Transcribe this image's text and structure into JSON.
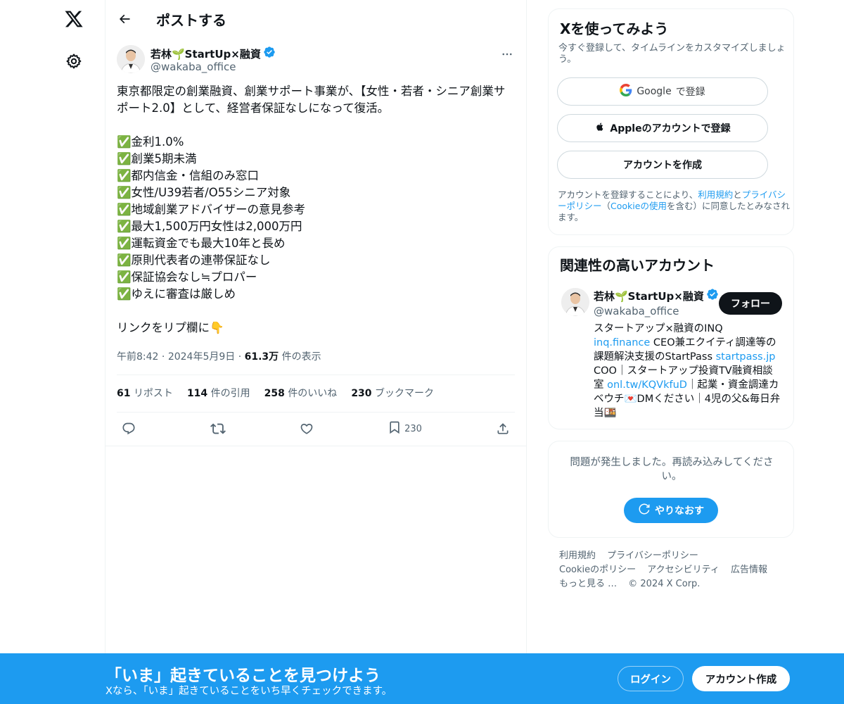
{
  "topbar": {
    "title": "ポストする"
  },
  "post": {
    "author_name": "若林🌱StartUp×融資",
    "author_handle": "@wakaba_office",
    "body": "東京都限定の創業融資、創業サポート事業が、【女性・若者・シニア創業サポート2.0】として、経営者保証なしになって復活。\n\n✅金利1.0%\n✅創業5期未満\n✅都内信金・信組のみ窓口\n✅女性/U39若者/O55シニア対象\n✅地域創業アドバイザーの意見参考\n✅最大1,500万円女性は2,000万円\n✅運転資金でも最大10年と長め\n✅原則代表者の連帯保証なし\n✅保証協会なし≒プロパー\n✅ゆえに審査は厳しめ\n\nリンクをリプ欄に👇",
    "time": "午前8:42",
    "date": "2024年5月9日",
    "views_count": "61.3万",
    "views_label": "件の表示",
    "stats": {
      "reposts_count": "61",
      "reposts_label": "リポスト",
      "quotes_count": "114",
      "quotes_label": "件の引用",
      "likes_count": "258",
      "likes_label": "件のいいね",
      "bookmarks_count": "230",
      "bookmarks_label": "ブックマーク"
    },
    "bookmark_action_count": "230"
  },
  "signup_card": {
    "title": "Xを使ってみよう",
    "subtitle": "今すぐ登録して、タイムラインをカスタマイズしましょう。",
    "google_brand": "Google",
    "google_suffix": "で登録",
    "apple_label": "Appleのアカウントで登録",
    "create_label": "アカウントを作成",
    "legal_1": "アカウントを登録することにより、",
    "legal_terms": "利用規約",
    "legal_and": "と",
    "legal_privacy": "プライバシーポリシー",
    "legal_2": "（",
    "legal_cookie": "Cookieの使用",
    "legal_3": "を含む）に同意したとみなされます。"
  },
  "related_card": {
    "title": "関連性の高いアカウント",
    "name": "若林🌱StartUp×融資",
    "handle": "@wakaba_office",
    "follow_label": "フォロー",
    "bio_1": "スタートアップ×融資のINQ",
    "bio_link1": "inq.finance",
    "bio_2": " CEO兼エクイティ調達等の課題解決支援のStartPass ",
    "bio_link2": "startpass.jp",
    "bio_3": " COO｜スタートアップ投資TV融資相談室 ",
    "bio_link3": "onl.tw/KQVkfuD",
    "bio_4": "｜起業・資金調達カベウチ💌DMください｜4児の父&毎日弁当🍱"
  },
  "error_card": {
    "message": "問題が発生しました。再読み込みしてください。",
    "retry_label": "やりなおす"
  },
  "footer": {
    "terms": "利用規約",
    "privacy": "プライバシーポリシー",
    "cookie": "Cookieのポリシー",
    "accessibility": "アクセシビリティ",
    "ads": "広告情報",
    "more": "もっと見る …",
    "copyright": "© 2024 X Corp."
  },
  "banner": {
    "title": "「いま」起きていることを見つけよう",
    "subtitle": "Xなら、「いま」起きていることをいち早くチェックできます。",
    "login_label": "ログイン",
    "signup_label": "アカウント作成"
  },
  "colors": {
    "accent": "#1d9bf0",
    "text": "#0f1419",
    "muted": "#536471",
    "border": "#eff3f4"
  },
  "icons": [
    "x-logo-icon",
    "gear-icon",
    "back-arrow-icon",
    "verified-badge-icon",
    "more-icon",
    "reply-icon",
    "repost-icon",
    "like-icon",
    "bookmark-icon",
    "share-icon",
    "google-icon",
    "apple-icon",
    "refresh-icon"
  ]
}
